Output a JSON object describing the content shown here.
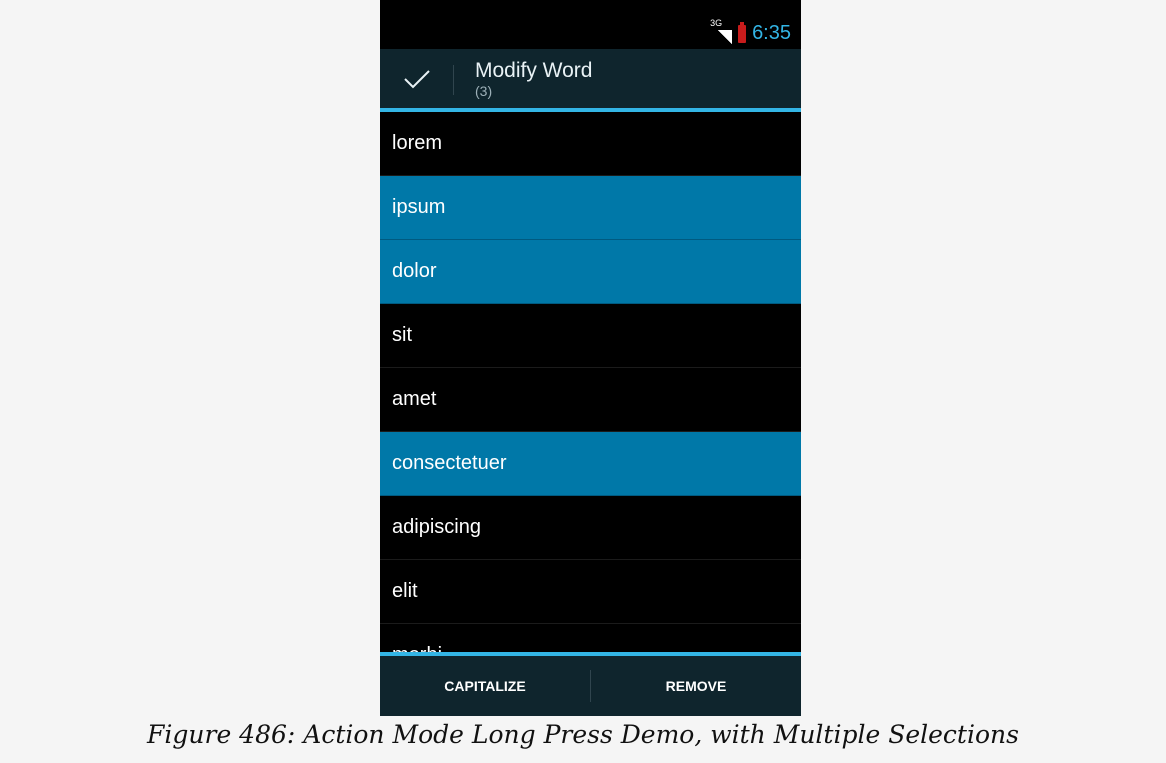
{
  "status_bar": {
    "network": "3G",
    "time": "6:35"
  },
  "action_mode": {
    "done_icon": "checkmark-icon",
    "title": "Modify Word",
    "subtitle": "(3)"
  },
  "list": {
    "items": [
      {
        "label": "lorem",
        "selected": false
      },
      {
        "label": "ipsum",
        "selected": true
      },
      {
        "label": "dolor",
        "selected": true
      },
      {
        "label": "sit",
        "selected": false
      },
      {
        "label": "amet",
        "selected": false
      },
      {
        "label": "consectetuer",
        "selected": true
      },
      {
        "label": "adipiscing",
        "selected": false
      },
      {
        "label": "elit",
        "selected": false
      },
      {
        "label": "morbi",
        "selected": false
      }
    ]
  },
  "bottom_actions": {
    "capitalize": "CAPITALIZE",
    "remove": "REMOVE"
  },
  "caption": "Figure 486: Action Mode Long Press Demo, with Multiple Selections",
  "colors": {
    "accent": "#33b5e5",
    "selected_row": "#0078a8",
    "action_bar": "#0f252d"
  }
}
